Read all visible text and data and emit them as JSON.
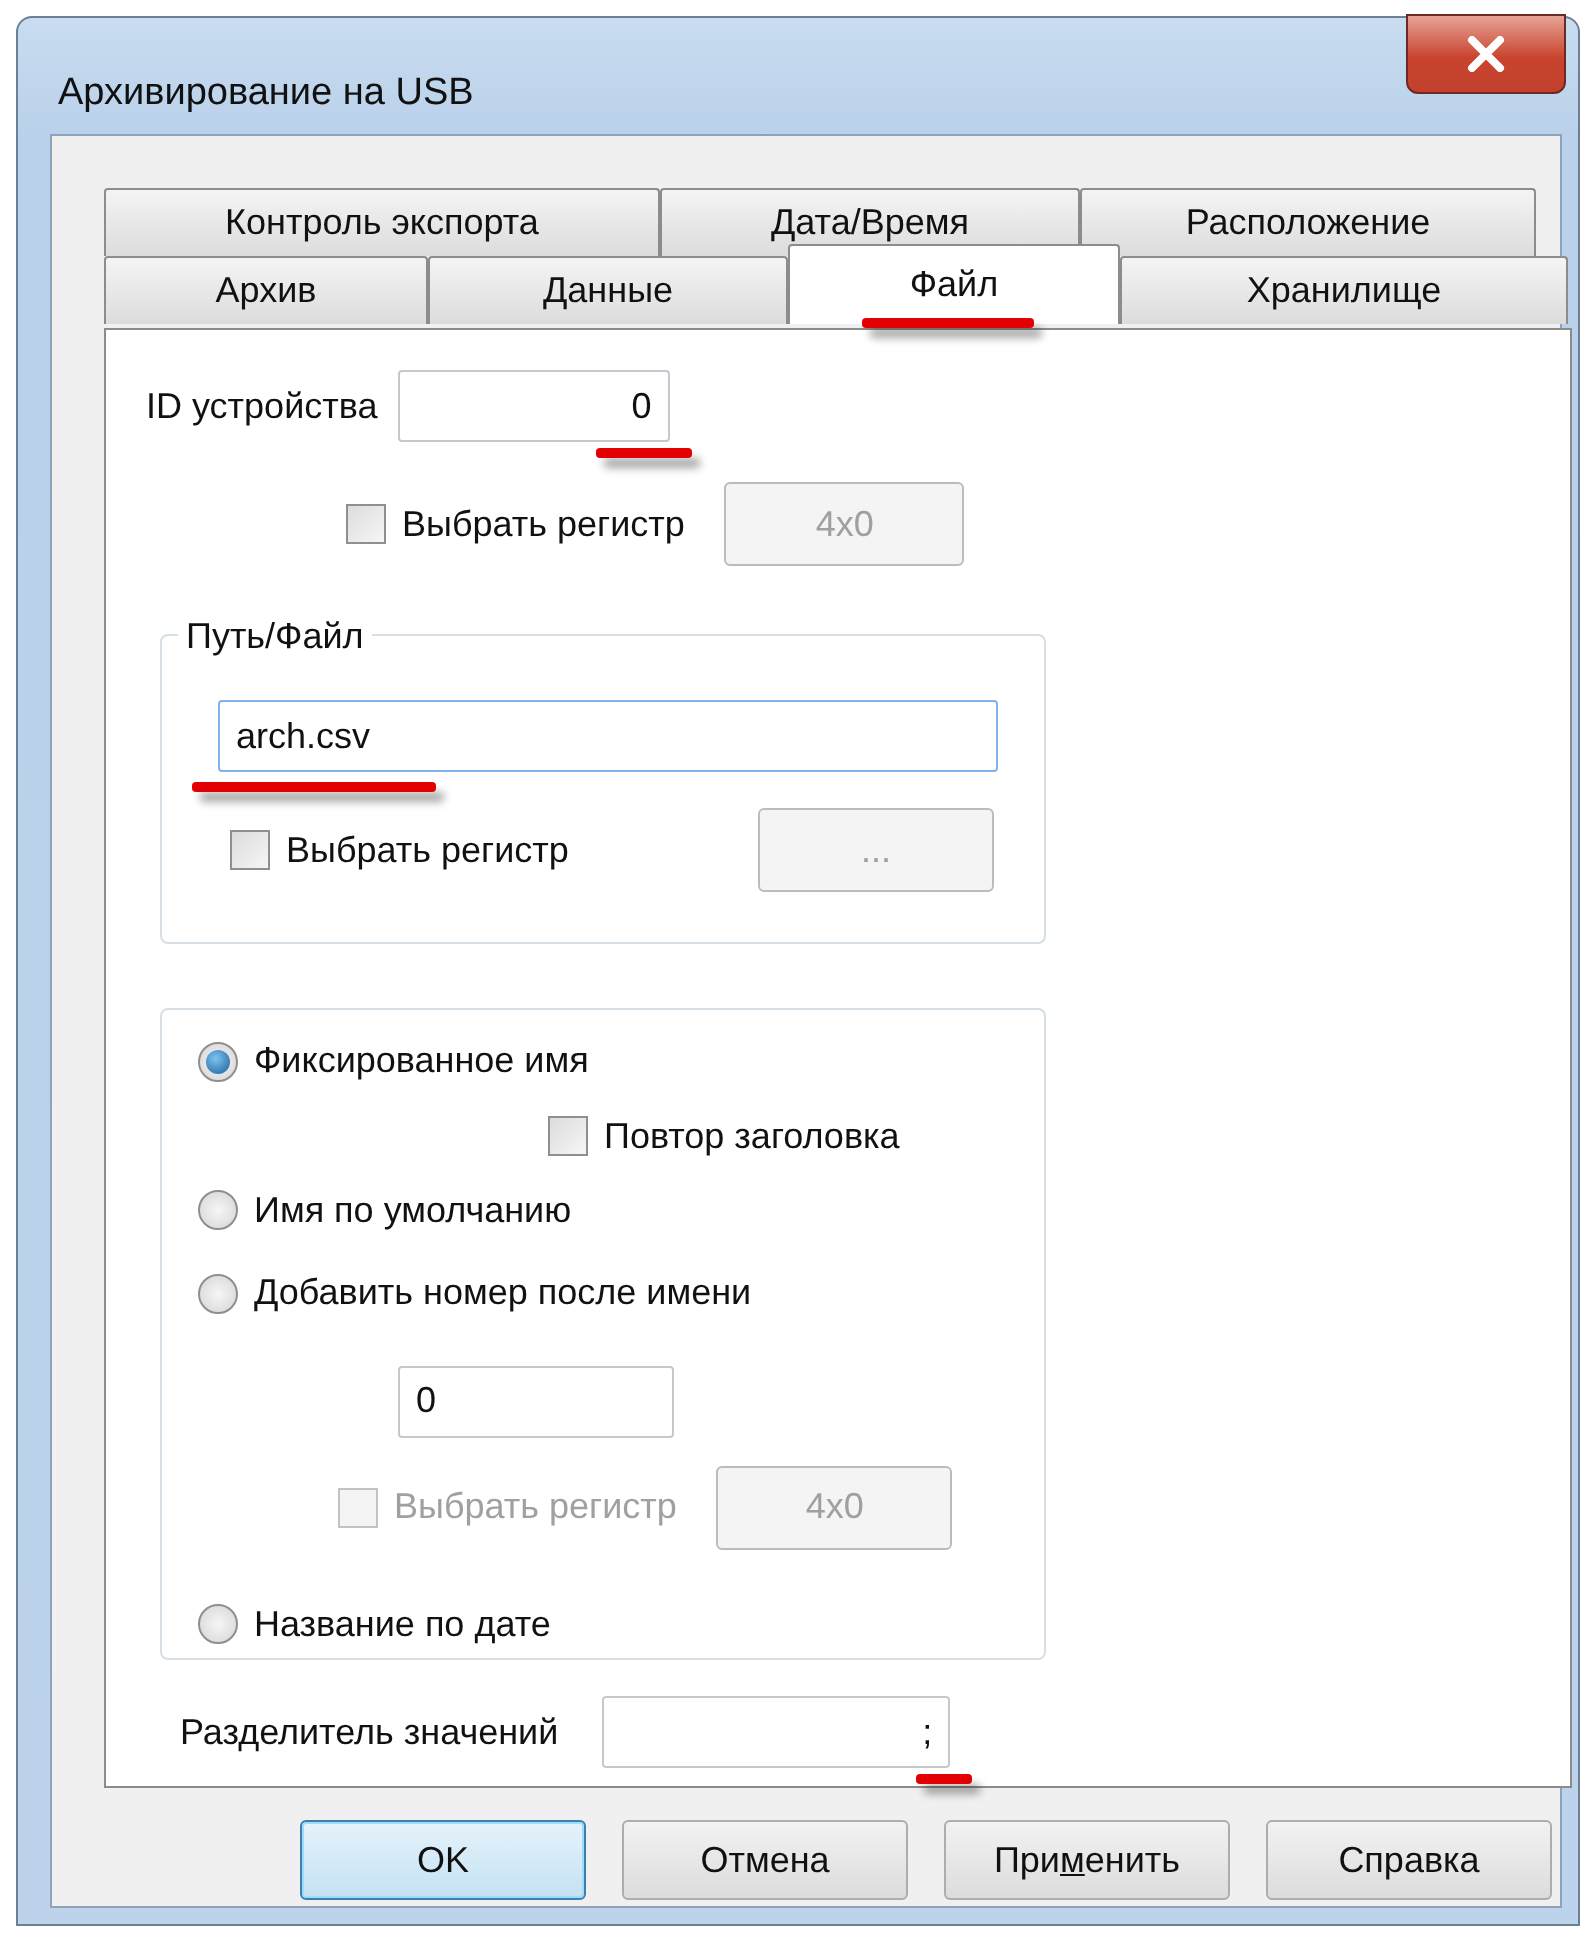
{
  "window": {
    "title": "Архивирование на USB"
  },
  "tab_rows": [
    [
      {
        "label": "Контроль экспорта",
        "selected": false,
        "highlighted": false
      },
      {
        "label": "Дата/Время",
        "selected": false,
        "highlighted": false
      },
      {
        "label": "Расположение",
        "selected": false,
        "highlighted": false
      }
    ],
    [
      {
        "label": "Архив",
        "selected": false,
        "highlighted": false
      },
      {
        "label": "Данные",
        "selected": false,
        "highlighted": false
      },
      {
        "label": "Файл",
        "selected": true,
        "highlighted": true
      },
      {
        "label": "Хранилище",
        "selected": false,
        "highlighted": false
      }
    ]
  ],
  "device_id": {
    "label": "ID устройства",
    "value": "0",
    "highlighted": true
  },
  "device_register": {
    "label": "Выбрать регистр",
    "checked": false,
    "disabled": false,
    "button": {
      "label": "4x0",
      "disabled": true
    }
  },
  "path_group": {
    "title": "Путь/Файл",
    "value": "arch.csv",
    "highlighted": true,
    "register": {
      "label": "Выбрать регистр",
      "checked": false,
      "disabled": false,
      "button": {
        "label": "...",
        "disabled": true
      }
    }
  },
  "naming_group": {
    "items": [
      {
        "kind": "radio",
        "label": "Фиксированное имя",
        "selected": true
      },
      {
        "kind": "checkbox",
        "label": "Повтор заголовка",
        "checked": false
      },
      {
        "kind": "radio",
        "label": "Имя по умолчанию",
        "selected": false
      },
      {
        "kind": "radio",
        "label": "Добавить номер после имени",
        "selected": false
      },
      {
        "kind": "field",
        "value": "0"
      },
      {
        "kind": "register",
        "label": "Выбрать регистр",
        "checked": false,
        "disabled": true,
        "button": {
          "label": "4x0",
          "disabled": true
        }
      },
      {
        "kind": "radio",
        "label": "Название по дате",
        "selected": false
      }
    ]
  },
  "separator": {
    "label": "Разделитель значений",
    "value": ";",
    "highlighted": true
  },
  "buttons": [
    {
      "label_parts": [
        "OK"
      ],
      "default": true
    },
    {
      "label_parts": [
        "Отмена"
      ],
      "default": false
    },
    {
      "label_parts": [
        "При",
        "м",
        "енить"
      ],
      "default": false
    },
    {
      "label_parts": [
        "Справка"
      ],
      "default": false
    }
  ]
}
